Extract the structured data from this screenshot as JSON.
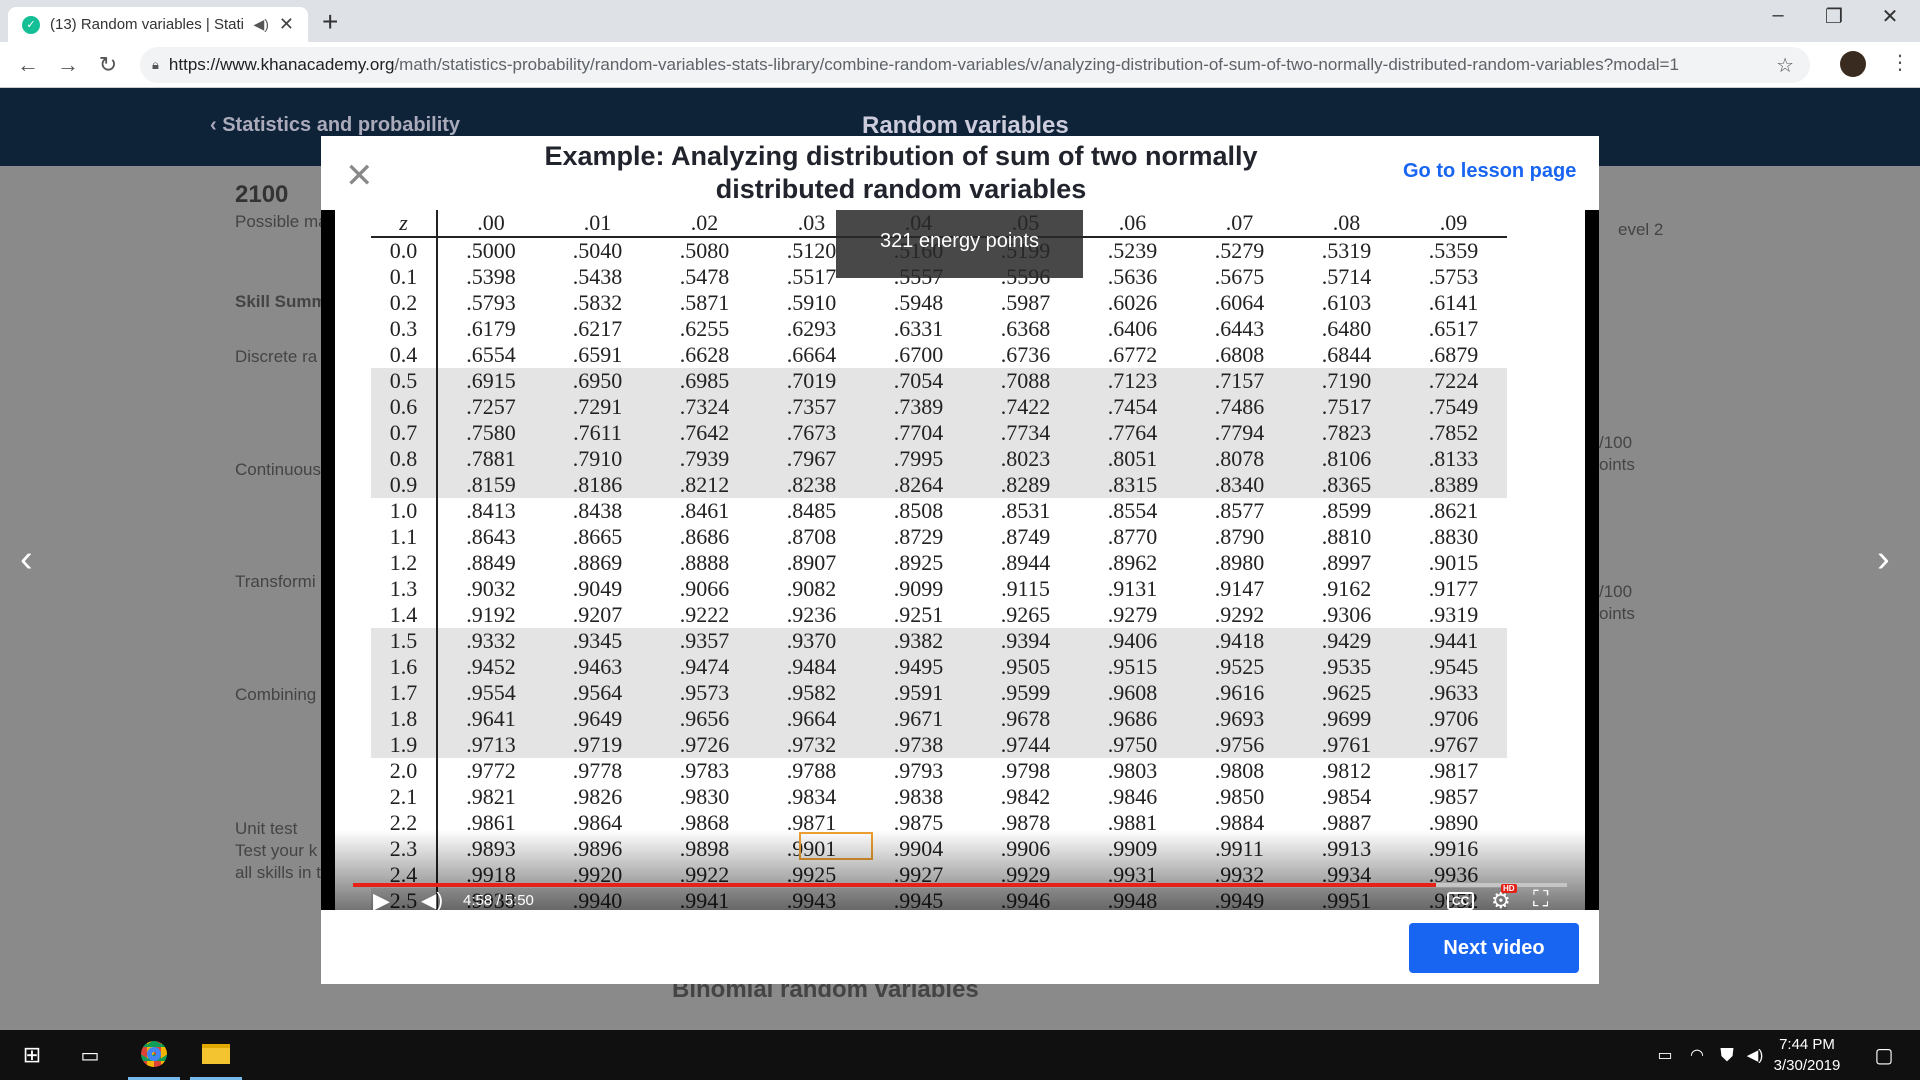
{
  "browser": {
    "tab_title": "(13) Random variables | Stati",
    "url_host": "https://www.khanacademy.org",
    "url_path": "/math/statistics-probability/random-variables-stats-library/combine-random-variables/v/analyzing-distribution-of-sum-of-two-normally-distributed-random-variables?modal=1"
  },
  "background": {
    "breadcrumb": "Statistics and probability",
    "unit_title": "Random variables",
    "points": "2100",
    "possible": "Possible ma",
    "skill_summary": "Skill Summ",
    "discrete": "Discrete ra",
    "continuous": "Continuous",
    "transforming": "Transformi",
    "combining": "Combining",
    "unit_test": "Unit test",
    "unit_test_desc1": "Test your k",
    "unit_test_desc2": "all skills in t",
    "level": "evel 2",
    "pts1a": "/100",
    "pts1b": "oints",
    "pts2a": "/100",
    "pts2b": "oints",
    "binomial": "Binomial random variables"
  },
  "modal": {
    "title": "Example: Analyzing distribution of sum of two normally distributed random variables",
    "lesson_link": "Go to lesson page",
    "next_button": "Next video"
  },
  "video": {
    "energy_points": "321 energy points",
    "time": "4:58 / 5:50",
    "progress_fraction": 0.892,
    "cc": "CC",
    "hd": "HD"
  },
  "z_table": {
    "headers": [
      "z",
      ".00",
      ".01",
      ".02",
      ".03",
      ".04",
      ".05",
      ".06",
      ".07",
      ".08",
      ".09"
    ],
    "rows": [
      [
        "0.0",
        ".5000",
        ".5040",
        ".5080",
        ".5120",
        ".5160",
        ".5199",
        ".5239",
        ".5279",
        ".5319",
        ".5359"
      ],
      [
        "0.1",
        ".5398",
        ".5438",
        ".5478",
        ".5517",
        ".5557",
        ".5596",
        ".5636",
        ".5675",
        ".5714",
        ".5753"
      ],
      [
        "0.2",
        ".5793",
        ".5832",
        ".5871",
        ".5910",
        ".5948",
        ".5987",
        ".6026",
        ".6064",
        ".6103",
        ".6141"
      ],
      [
        "0.3",
        ".6179",
        ".6217",
        ".6255",
        ".6293",
        ".6331",
        ".6368",
        ".6406",
        ".6443",
        ".6480",
        ".6517"
      ],
      [
        "0.4",
        ".6554",
        ".6591",
        ".6628",
        ".6664",
        ".6700",
        ".6736",
        ".6772",
        ".6808",
        ".6844",
        ".6879"
      ],
      [
        "0.5",
        ".6915",
        ".6950",
        ".6985",
        ".7019",
        ".7054",
        ".7088",
        ".7123",
        ".7157",
        ".7190",
        ".7224"
      ],
      [
        "0.6",
        ".7257",
        ".7291",
        ".7324",
        ".7357",
        ".7389",
        ".7422",
        ".7454",
        ".7486",
        ".7517",
        ".7549"
      ],
      [
        "0.7",
        ".7580",
        ".7611",
        ".7642",
        ".7673",
        ".7704",
        ".7734",
        ".7764",
        ".7794",
        ".7823",
        ".7852"
      ],
      [
        "0.8",
        ".7881",
        ".7910",
        ".7939",
        ".7967",
        ".7995",
        ".8023",
        ".8051",
        ".8078",
        ".8106",
        ".8133"
      ],
      [
        "0.9",
        ".8159",
        ".8186",
        ".8212",
        ".8238",
        ".8264",
        ".8289",
        ".8315",
        ".8340",
        ".8365",
        ".8389"
      ],
      [
        "1.0",
        ".8413",
        ".8438",
        ".8461",
        ".8485",
        ".8508",
        ".8531",
        ".8554",
        ".8577",
        ".8599",
        ".8621"
      ],
      [
        "1.1",
        ".8643",
        ".8665",
        ".8686",
        ".8708",
        ".8729",
        ".8749",
        ".8770",
        ".8790",
        ".8810",
        ".8830"
      ],
      [
        "1.2",
        ".8849",
        ".8869",
        ".8888",
        ".8907",
        ".8925",
        ".8944",
        ".8962",
        ".8980",
        ".8997",
        ".9015"
      ],
      [
        "1.3",
        ".9032",
        ".9049",
        ".9066",
        ".9082",
        ".9099",
        ".9115",
        ".9131",
        ".9147",
        ".9162",
        ".9177"
      ],
      [
        "1.4",
        ".9192",
        ".9207",
        ".9222",
        ".9236",
        ".9251",
        ".9265",
        ".9279",
        ".9292",
        ".9306",
        ".9319"
      ],
      [
        "1.5",
        ".9332",
        ".9345",
        ".9357",
        ".9370",
        ".9382",
        ".9394",
        ".9406",
        ".9418",
        ".9429",
        ".9441"
      ],
      [
        "1.6",
        ".9452",
        ".9463",
        ".9474",
        ".9484",
        ".9495",
        ".9505",
        ".9515",
        ".9525",
        ".9535",
        ".9545"
      ],
      [
        "1.7",
        ".9554",
        ".9564",
        ".9573",
        ".9582",
        ".9591",
        ".9599",
        ".9608",
        ".9616",
        ".9625",
        ".9633"
      ],
      [
        "1.8",
        ".9641",
        ".9649",
        ".9656",
        ".9664",
        ".9671",
        ".9678",
        ".9686",
        ".9693",
        ".9699",
        ".9706"
      ],
      [
        "1.9",
        ".9713",
        ".9719",
        ".9726",
        ".9732",
        ".9738",
        ".9744",
        ".9750",
        ".9756",
        ".9761",
        ".9767"
      ],
      [
        "2.0",
        ".9772",
        ".9778",
        ".9783",
        ".9788",
        ".9793",
        ".9798",
        ".9803",
        ".9808",
        ".9812",
        ".9817"
      ],
      [
        "2.1",
        ".9821",
        ".9826",
        ".9830",
        ".9834",
        ".9838",
        ".9842",
        ".9846",
        ".9850",
        ".9854",
        ".9857"
      ],
      [
        "2.2",
        ".9861",
        ".9864",
        ".9868",
        ".9871",
        ".9875",
        ".9878",
        ".9881",
        ".9884",
        ".9887",
        ".9890"
      ],
      [
        "2.3",
        ".9893",
        ".9896",
        ".9898",
        ".9901",
        ".9904",
        ".9906",
        ".9909",
        ".9911",
        ".9913",
        ".9916"
      ],
      [
        "2.4",
        ".9918",
        ".9920",
        ".9922",
        ".9925",
        ".9927",
        ".9929",
        ".9931",
        ".9932",
        ".9934",
        ".9936"
      ],
      [
        "2.5",
        ".9938",
        ".9940",
        ".9941",
        ".9943",
        ".9945",
        ".9946",
        ".9948",
        ".9949",
        ".9951",
        ".9952"
      ]
    ],
    "shaded_rows": [
      5,
      6,
      7,
      8,
      9,
      15,
      16,
      17,
      18,
      19,
      25
    ]
  },
  "taskbar": {
    "time": "7:44 PM",
    "date": "3/30/2019"
  }
}
